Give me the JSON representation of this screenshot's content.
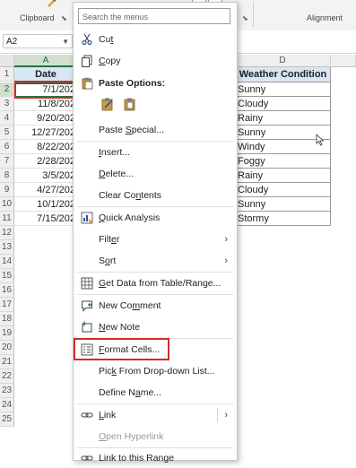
{
  "ribbon": {
    "clipboard_label": "Clipboard",
    "alignment_label": "Alignment"
  },
  "name_box": {
    "value": "A2"
  },
  "columns": [
    "A",
    "D"
  ],
  "row_numbers": [
    "1",
    "2",
    "3",
    "4",
    "5",
    "6",
    "7",
    "8",
    "9",
    "10",
    "11",
    "12",
    "13",
    "14",
    "15",
    "16",
    "17",
    "18",
    "19",
    "20",
    "21",
    "22",
    "23",
    "24",
    "25"
  ],
  "sheet": {
    "date_header": "Date",
    "weather_header": "Weather Condition",
    "dates": [
      "7/1/202",
      "11/8/202",
      "9/20/202",
      "12/27/202",
      "8/22/202",
      "2/28/202",
      "3/5/202",
      "4/27/202",
      "10/1/202",
      "7/15/202"
    ],
    "conditions": [
      "Sunny",
      "Cloudy",
      "Rainy",
      "Sunny",
      "Windy",
      "Foggy",
      "Rainy",
      "Cloudy",
      "Sunny",
      "Stormy"
    ]
  },
  "context_menu": {
    "search_placeholder": "Search the menus",
    "items": {
      "cut": {
        "pre": "Cu",
        "u": "t",
        "post": ""
      },
      "copy": {
        "pre": "",
        "u": "C",
        "post": "opy"
      },
      "paste_options": "Paste Options:",
      "paste_special": {
        "pre": "Paste ",
        "u": "S",
        "post": "pecial..."
      },
      "insert": {
        "pre": "",
        "u": "I",
        "post": "nsert..."
      },
      "delete": {
        "pre": "",
        "u": "D",
        "post": "elete..."
      },
      "clear_contents": {
        "pre": "Clear Co",
        "u": "n",
        "post": "tents"
      },
      "quick_analysis": {
        "pre": "",
        "u": "Q",
        "post": "uick Analysis"
      },
      "filter": {
        "pre": "Filt",
        "u": "e",
        "post": "r"
      },
      "sort": {
        "pre": "S",
        "u": "o",
        "post": "rt"
      },
      "get_data": {
        "pre": "",
        "u": "G",
        "post": "et Data from Table/Range..."
      },
      "new_comment": {
        "pre": "New Co",
        "u": "m",
        "post": "ment"
      },
      "new_note": {
        "pre": "",
        "u": "N",
        "post": "ew Note"
      },
      "format_cells": {
        "pre": "",
        "u": "F",
        "post": "ormat Cells..."
      },
      "pick_list": {
        "pre": "Pic",
        "u": "k",
        "post": " From Drop-down List..."
      },
      "define_name": {
        "pre": "Define N",
        "u": "a",
        "post": "me..."
      },
      "link": {
        "pre": "",
        "u": "L",
        "post": "ink"
      },
      "open_hyperlink": {
        "pre": "",
        "u": "O",
        "post": "pen Hyperlink"
      },
      "link_range": {
        "pre": "Link to this Range",
        "u": "",
        "post": ""
      }
    }
  },
  "colors": {
    "accent_green": "#217346",
    "highlight_red": "#d42a2a",
    "header_fill": "#d9e6f5"
  }
}
